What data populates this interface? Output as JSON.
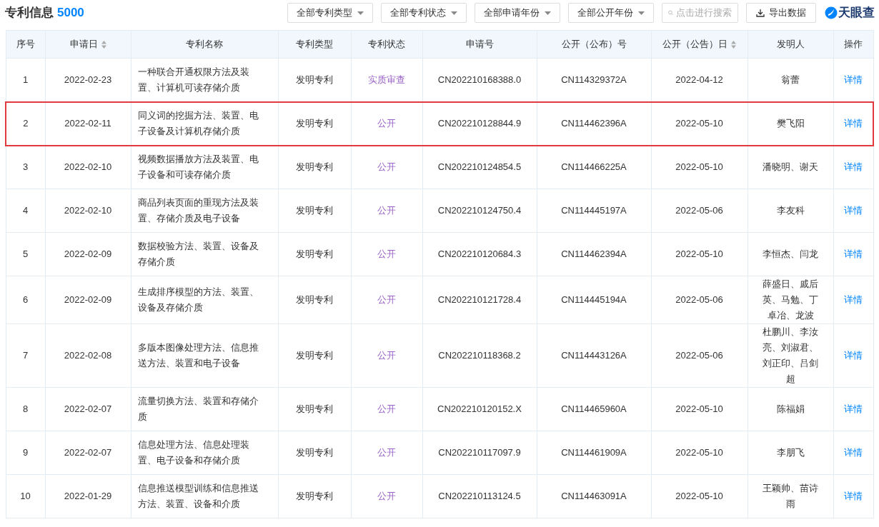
{
  "header": {
    "title": "专利信息",
    "count": "5000",
    "filters": [
      "全部专利类型",
      "全部专利状态",
      "全部申请年份",
      "全部公开年份"
    ],
    "search": {
      "placeholder": "点击进行搜索"
    },
    "export_button": "导出数据",
    "logo": "天眼查"
  },
  "table": {
    "columns": [
      {
        "label": "序号",
        "sortable": false
      },
      {
        "label": "申请日",
        "sortable": true
      },
      {
        "label": "专利名称",
        "sortable": false
      },
      {
        "label": "专利类型",
        "sortable": false
      },
      {
        "label": "专利状态",
        "sortable": false
      },
      {
        "label": "申请号",
        "sortable": false
      },
      {
        "label": "公开（公布）号",
        "sortable": false
      },
      {
        "label": "公开（公告）日",
        "sortable": true
      },
      {
        "label": "发明人",
        "sortable": false
      },
      {
        "label": "操作",
        "sortable": false
      }
    ],
    "rows": [
      {
        "highlighted": false,
        "cells": [
          "1",
          "2022-02-23",
          "一种联合开通权限方法及装置、计算机可读存储介质",
          "发明专利",
          "实质审查",
          "CN202210168388.0",
          "CN114329372A",
          "2022-04-12",
          "翁蕾",
          "详情"
        ]
      },
      {
        "highlighted": true,
        "cells": [
          "2",
          "2022-02-11",
          "同义词的挖掘方法、装置、电子设备及计算机存储介质",
          "发明专利",
          "公开",
          "CN202210128844.9",
          "CN114462396A",
          "2022-05-10",
          "樊飞阳",
          "详情"
        ]
      },
      {
        "highlighted": false,
        "cells": [
          "3",
          "2022-02-10",
          "视频数据播放方法及装置、电子设备和可读存储介质",
          "发明专利",
          "公开",
          "CN202210124854.5",
          "CN114466225A",
          "2022-05-10",
          "潘晓明、谢天",
          "详情"
        ]
      },
      {
        "highlighted": false,
        "cells": [
          "4",
          "2022-02-10",
          "商品列表页面的重现方法及装置、存储介质及电子设备",
          "发明专利",
          "公开",
          "CN202210124750.4",
          "CN114445197A",
          "2022-05-06",
          "李友科",
          "详情"
        ]
      },
      {
        "highlighted": false,
        "cells": [
          "5",
          "2022-02-09",
          "数据校验方法、装置、设备及存储介质",
          "发明专利",
          "公开",
          "CN202210120684.3",
          "CN114462394A",
          "2022-05-10",
          "李恒杰、闫龙",
          "详情"
        ]
      },
      {
        "highlighted": false,
        "cells": [
          "6",
          "2022-02-09",
          "生成排序模型的方法、装置、设备及存储介质",
          "发明专利",
          "公开",
          "CN202210121728.4",
          "CN114445194A",
          "2022-05-06",
          "薛盛日、戚后英、马勉、丁卓冶、龙波",
          "详情"
        ]
      },
      {
        "highlighted": false,
        "cells": [
          "7",
          "2022-02-08",
          "多版本图像处理方法、信息推送方法、装置和电子设备",
          "发明专利",
          "公开",
          "CN202210118368.2",
          "CN114443126A",
          "2022-05-06",
          "杜鹏川、李汝亮、刘淑君、刘正印、吕剑超",
          "详情"
        ]
      },
      {
        "highlighted": false,
        "cells": [
          "8",
          "2022-02-07",
          "流量切换方法、装置和存储介质",
          "发明专利",
          "公开",
          "CN202210120152.X",
          "CN114465960A",
          "2022-05-10",
          "陈福娟",
          "详情"
        ]
      },
      {
        "highlighted": false,
        "cells": [
          "9",
          "2022-02-07",
          "信息处理方法、信息处理装置、电子设备和存储介质",
          "发明专利",
          "公开",
          "CN202210117097.9",
          "CN114461909A",
          "2022-05-10",
          "李朋飞",
          "详情"
        ]
      },
      {
        "highlighted": false,
        "cells": [
          "10",
          "2022-01-29",
          "信息推送模型训练和信息推送方法、装置、设备和介质",
          "发明专利",
          "公开",
          "CN202210113124.5",
          "CN114463091A",
          "2022-05-10",
          "王颖帅、苗诗雨",
          "详情"
        ]
      }
    ]
  }
}
